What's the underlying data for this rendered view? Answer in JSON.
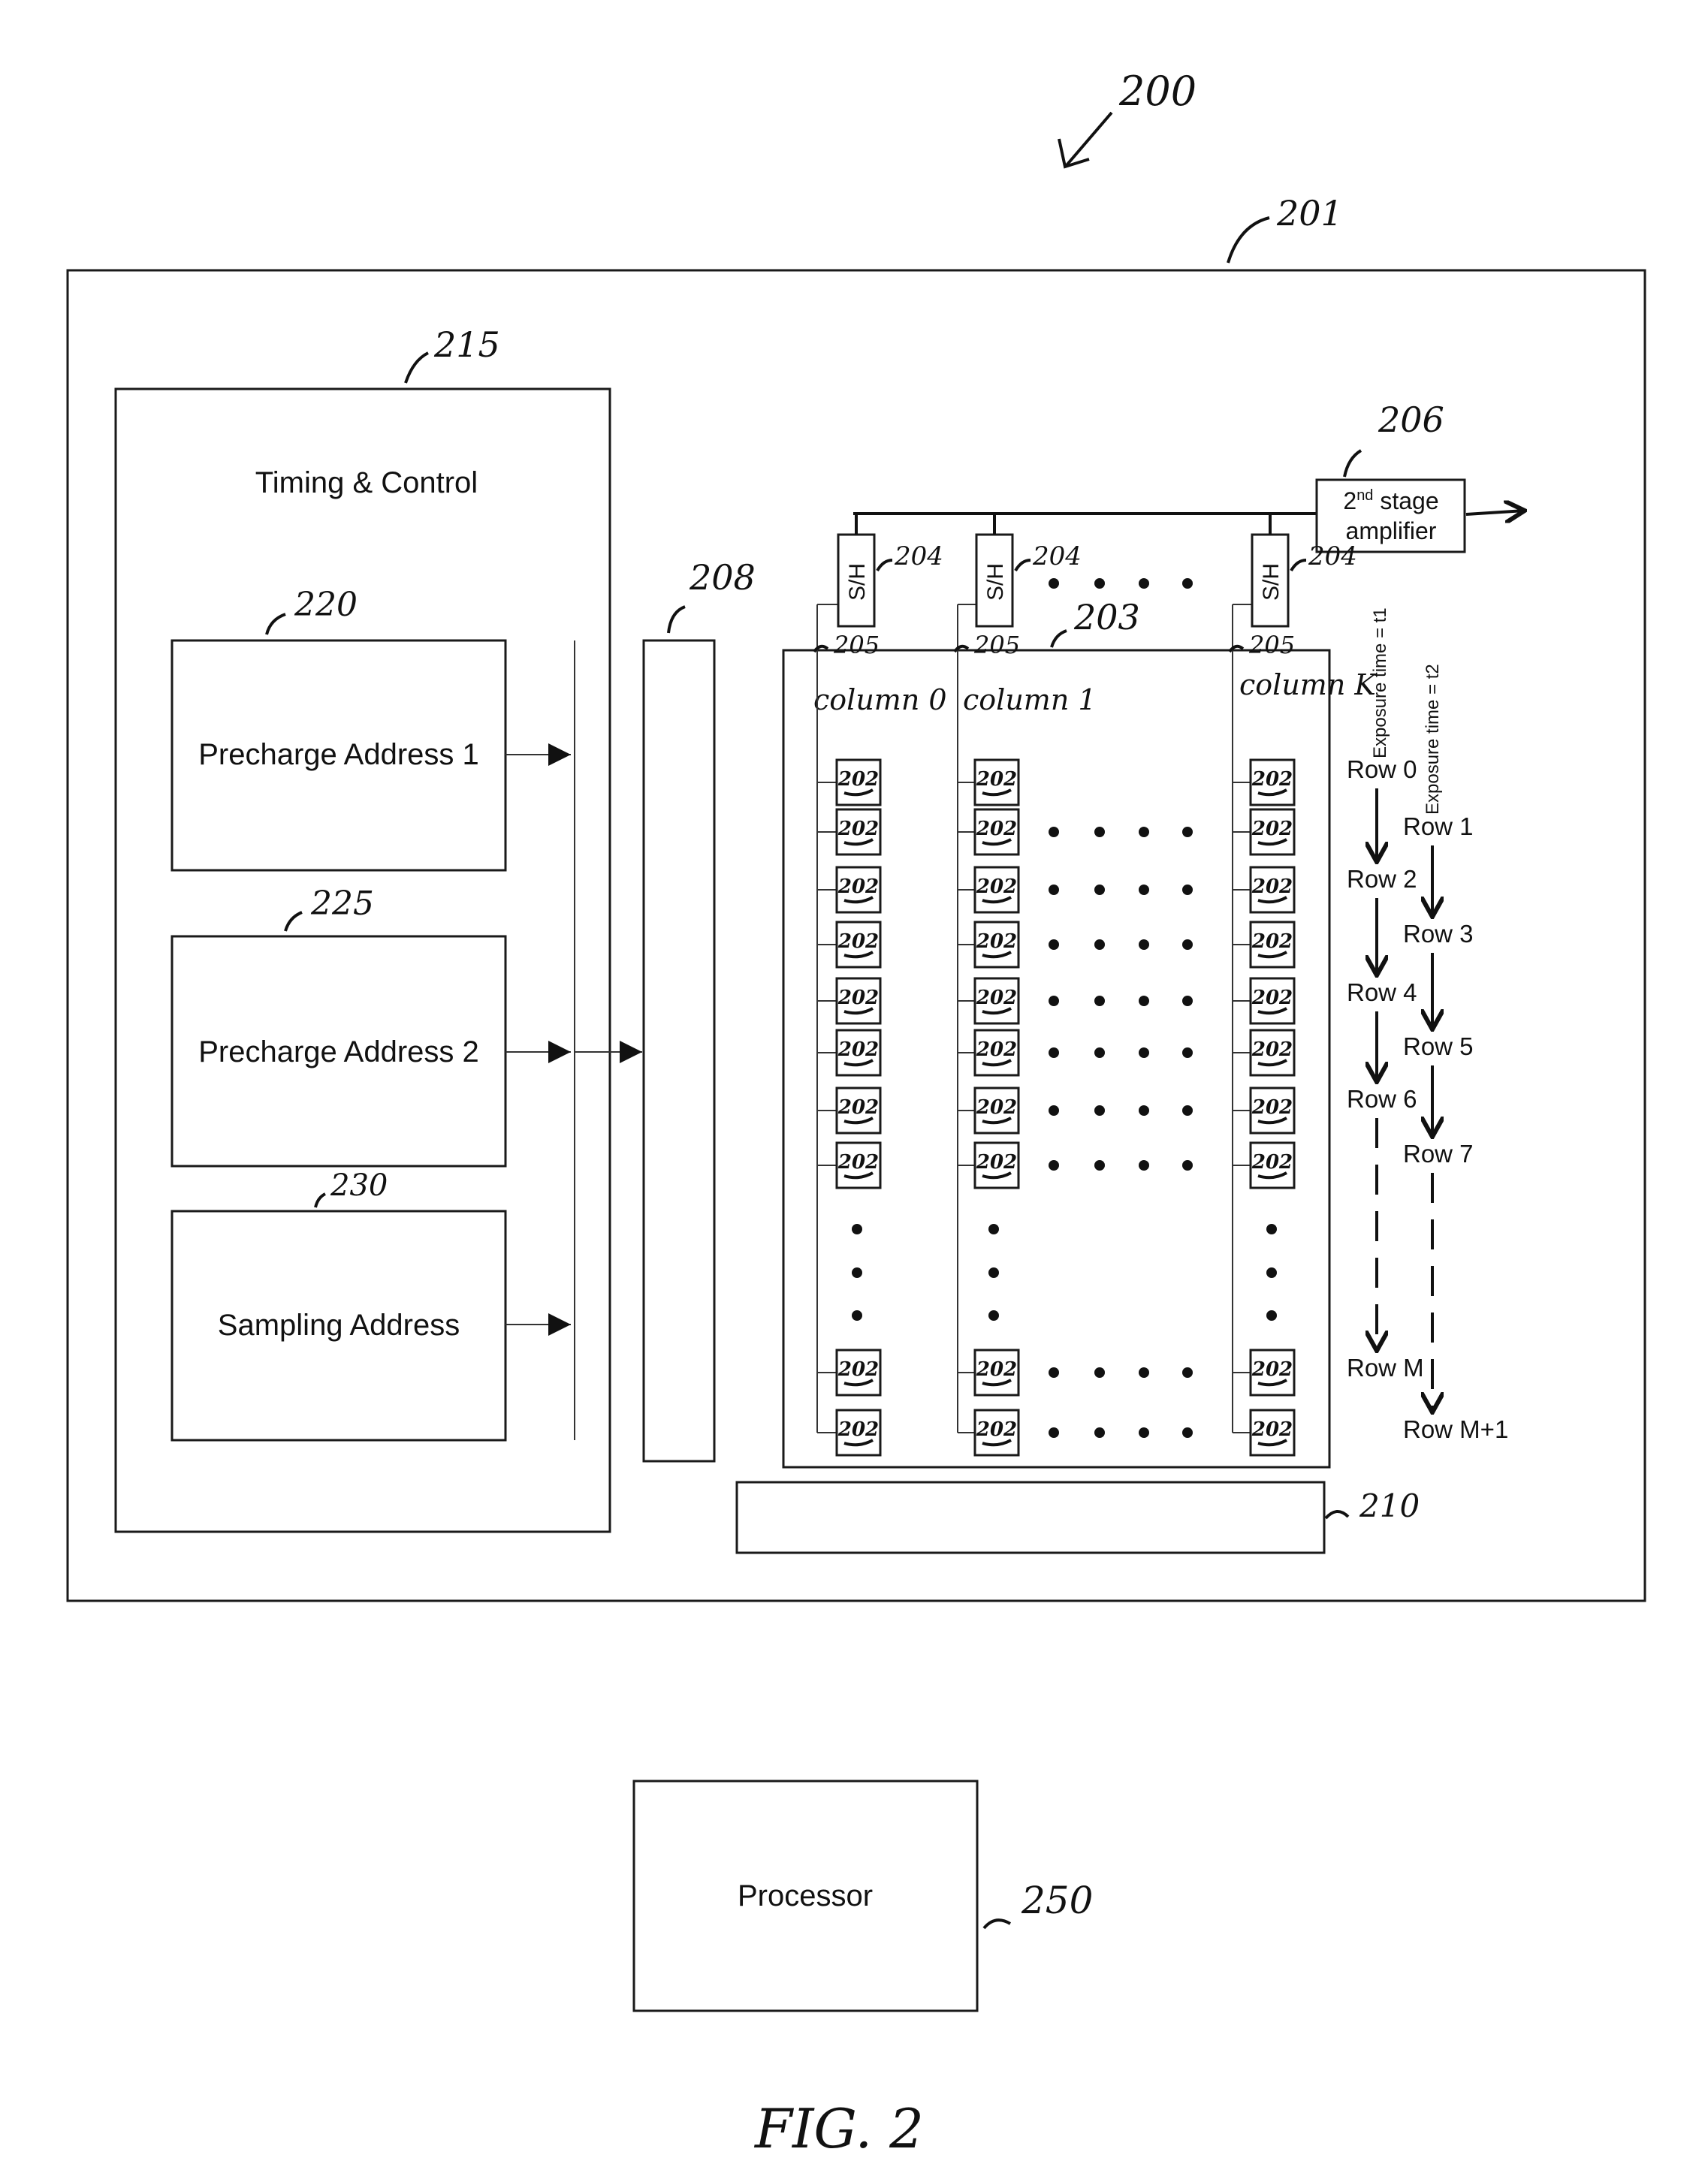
{
  "figure": {
    "caption": "FIG. 2",
    "ref_system": "200",
    "ref_chip": "201"
  },
  "timing_control": {
    "ref": "215",
    "title": "Timing & Control",
    "blocks": [
      {
        "ref": "220",
        "label": "Precharge Address 1"
      },
      {
        "ref": "225",
        "label": "Precharge Address 2"
      },
      {
        "ref": "230",
        "label": "Sampling Address"
      }
    ]
  },
  "row_driver": {
    "ref": "208"
  },
  "pixel_array": {
    "ref": "203",
    "cell_ref": "202",
    "columns": [
      {
        "label": "column 0",
        "line_ref": "205",
        "sh_label": "S/H",
        "sh_ref": "204"
      },
      {
        "label": "column 1",
        "line_ref": "205",
        "sh_label": "S/H",
        "sh_ref": "204"
      },
      {
        "label": "column K",
        "line_ref": "205",
        "sh_label": "S/H",
        "sh_ref": "204"
      }
    ]
  },
  "amplifier": {
    "ref": "206",
    "line1": "2nd stage",
    "sup": "nd",
    "line2": "amplifier"
  },
  "readout_bar": {
    "ref": "210"
  },
  "exposure": {
    "t1_label": "Exposure time = t1",
    "t2_label": "Exposure time = t2",
    "t1_rows": [
      "Row 0",
      "Row 2",
      "Row 4",
      "Row 6",
      "Row M"
    ],
    "t2_rows": [
      "Row 1",
      "Row 3",
      "Row 5",
      "Row 7",
      "Row M+1"
    ]
  },
  "processor": {
    "ref": "250",
    "label": "Processor"
  }
}
